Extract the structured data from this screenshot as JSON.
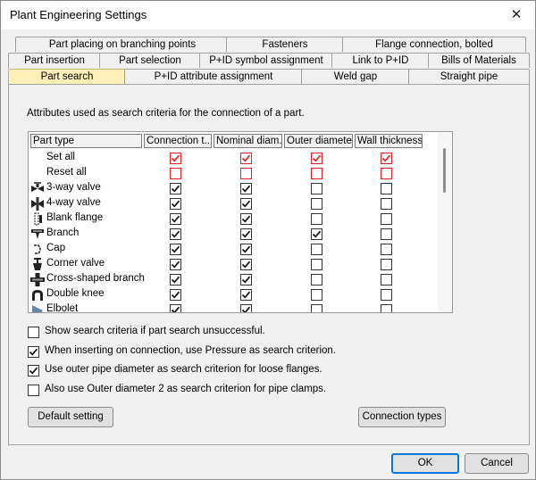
{
  "window": {
    "title": "Plant Engineering Settings",
    "close_glyph": "✕"
  },
  "tabs": {
    "row1": [
      "Part placing on branching points",
      "Fasteners",
      "Flange connection, bolted"
    ],
    "row2": [
      "Part insertion",
      "Part selection",
      "P+ID symbol assignment",
      "Link to P+ID",
      "Bills of Materials"
    ],
    "row3": [
      "Part search",
      "P+ID attribute assignment",
      "Weld gap",
      "Straight pipe"
    ],
    "selected": "Part search"
  },
  "panel": {
    "description": "Attributes used as search criteria for the connection of a part."
  },
  "grid": {
    "columns": [
      "Part type",
      "Connection t...",
      "Nominal diam...",
      "Outer diameter",
      "Wall thickness"
    ],
    "rows": [
      {
        "label": "Set all",
        "icon": "none",
        "checks": [
          true,
          true,
          true,
          true
        ],
        "red": true
      },
      {
        "label": "Reset all",
        "icon": "none",
        "checks": [
          false,
          false,
          false,
          false
        ],
        "red": true
      },
      {
        "label": "3-way valve",
        "icon": "three-way-valve-icon",
        "checks": [
          true,
          true,
          false,
          false
        ],
        "red": false
      },
      {
        "label": "4-way valve",
        "icon": "four-way-valve-icon",
        "checks": [
          true,
          true,
          false,
          false
        ],
        "red": false
      },
      {
        "label": "Blank flange",
        "icon": "blank-flange-icon",
        "checks": [
          true,
          true,
          false,
          false
        ],
        "red": false
      },
      {
        "label": "Branch",
        "icon": "branch-icon",
        "checks": [
          true,
          true,
          true,
          false
        ],
        "red": false
      },
      {
        "label": "Cap",
        "icon": "cap-icon",
        "checks": [
          true,
          true,
          false,
          false
        ],
        "red": false
      },
      {
        "label": "Corner valve",
        "icon": "corner-valve-icon",
        "checks": [
          true,
          true,
          false,
          false
        ],
        "red": false
      },
      {
        "label": "Cross-shaped branch",
        "icon": "cross-branch-icon",
        "checks": [
          true,
          true,
          false,
          false
        ],
        "red": false
      },
      {
        "label": "Double knee",
        "icon": "double-knee-icon",
        "checks": [
          true,
          true,
          false,
          false
        ],
        "red": false
      },
      {
        "label": "Elbolet",
        "icon": "elbolet-icon",
        "checks": [
          true,
          true,
          false,
          false
        ],
        "red": false
      }
    ]
  },
  "options": [
    {
      "label": "Show search criteria if part search unsuccessful.",
      "checked": false
    },
    {
      "label": "When inserting on connection, use Pressure as search criterion.",
      "checked": true
    },
    {
      "label": "Use outer pipe diameter as search criterion for loose flanges.",
      "checked": true
    },
    {
      "label": "Also use Outer diameter 2 as search criterion for pipe clamps.",
      "checked": false
    }
  ],
  "buttons": {
    "default_setting": "Default setting",
    "connection_types": "Connection types",
    "ok": "OK",
    "cancel": "Cancel"
  },
  "colors": {
    "selected_tab": "#fff0b8",
    "red_checkbox": "#e02020",
    "focus_border": "#0078d7"
  }
}
